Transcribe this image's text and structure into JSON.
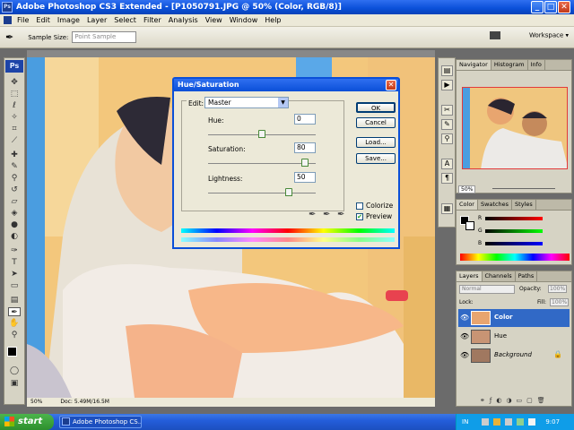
{
  "window": {
    "title": "Adobe Photoshop CS3 Extended - [P1050791.JPG @ 50% (Color, RGB/8)]"
  },
  "menubar": {
    "items": [
      "File",
      "Edit",
      "Image",
      "Layer",
      "Select",
      "Filter",
      "Analysis",
      "View",
      "Window",
      "Help"
    ]
  },
  "options": {
    "sample_size_label": "Sample Size:",
    "sample_size_value": "Point Sample",
    "workspace_label": "Workspace ▾"
  },
  "toolbox": {
    "logo": "Ps"
  },
  "document": {
    "zoom": "50%",
    "doc_size": "Doc: 5.49M/16.5M"
  },
  "navigator_panel": {
    "tabs": [
      "Navigator",
      "Histogram",
      "Info"
    ],
    "zoom": "50%"
  },
  "color_panel": {
    "tabs": [
      "Color",
      "Swatches",
      "Styles"
    ],
    "channels": [
      "R",
      "G",
      "B"
    ]
  },
  "layers_panel": {
    "tabs": [
      "Layers",
      "Channels",
      "Paths"
    ],
    "blend_mode": "Normal",
    "opacity_label": "Opacity:",
    "opacity_value": "100%",
    "lock_label": "Lock:",
    "fill_label": "Fill:",
    "fill_value": "100%",
    "layers": [
      {
        "name": "Color",
        "selected": true
      },
      {
        "name": "Hue",
        "selected": false
      },
      {
        "name": "Background",
        "selected": false
      }
    ]
  },
  "dialog": {
    "title": "Hue/Saturation",
    "edit_label": "Edit:",
    "edit_value": "Master",
    "hue_label": "Hue:",
    "hue_value": "0",
    "saturation_label": "Saturation:",
    "saturation_value": "80",
    "lightness_label": "Lightness:",
    "lightness_value": "50",
    "buttons": {
      "ok": "OK",
      "cancel": "Cancel",
      "load": "Load...",
      "save": "Save..."
    },
    "colorize_label": "Colorize",
    "colorize_checked": false,
    "preview_label": "Preview",
    "preview_checked": true,
    "slider_levels": {
      "hue": 0.5,
      "saturation": 0.9,
      "lightness": 0.75
    }
  },
  "taskbar": {
    "start_label": "start",
    "task_label": "Adobe Photoshop CS...",
    "language": "IN",
    "clock": "9:07"
  },
  "colors": {
    "xp_blue": "#245edb",
    "dialog_face": "#ece9d8",
    "layer_selected": "#3169c6"
  }
}
